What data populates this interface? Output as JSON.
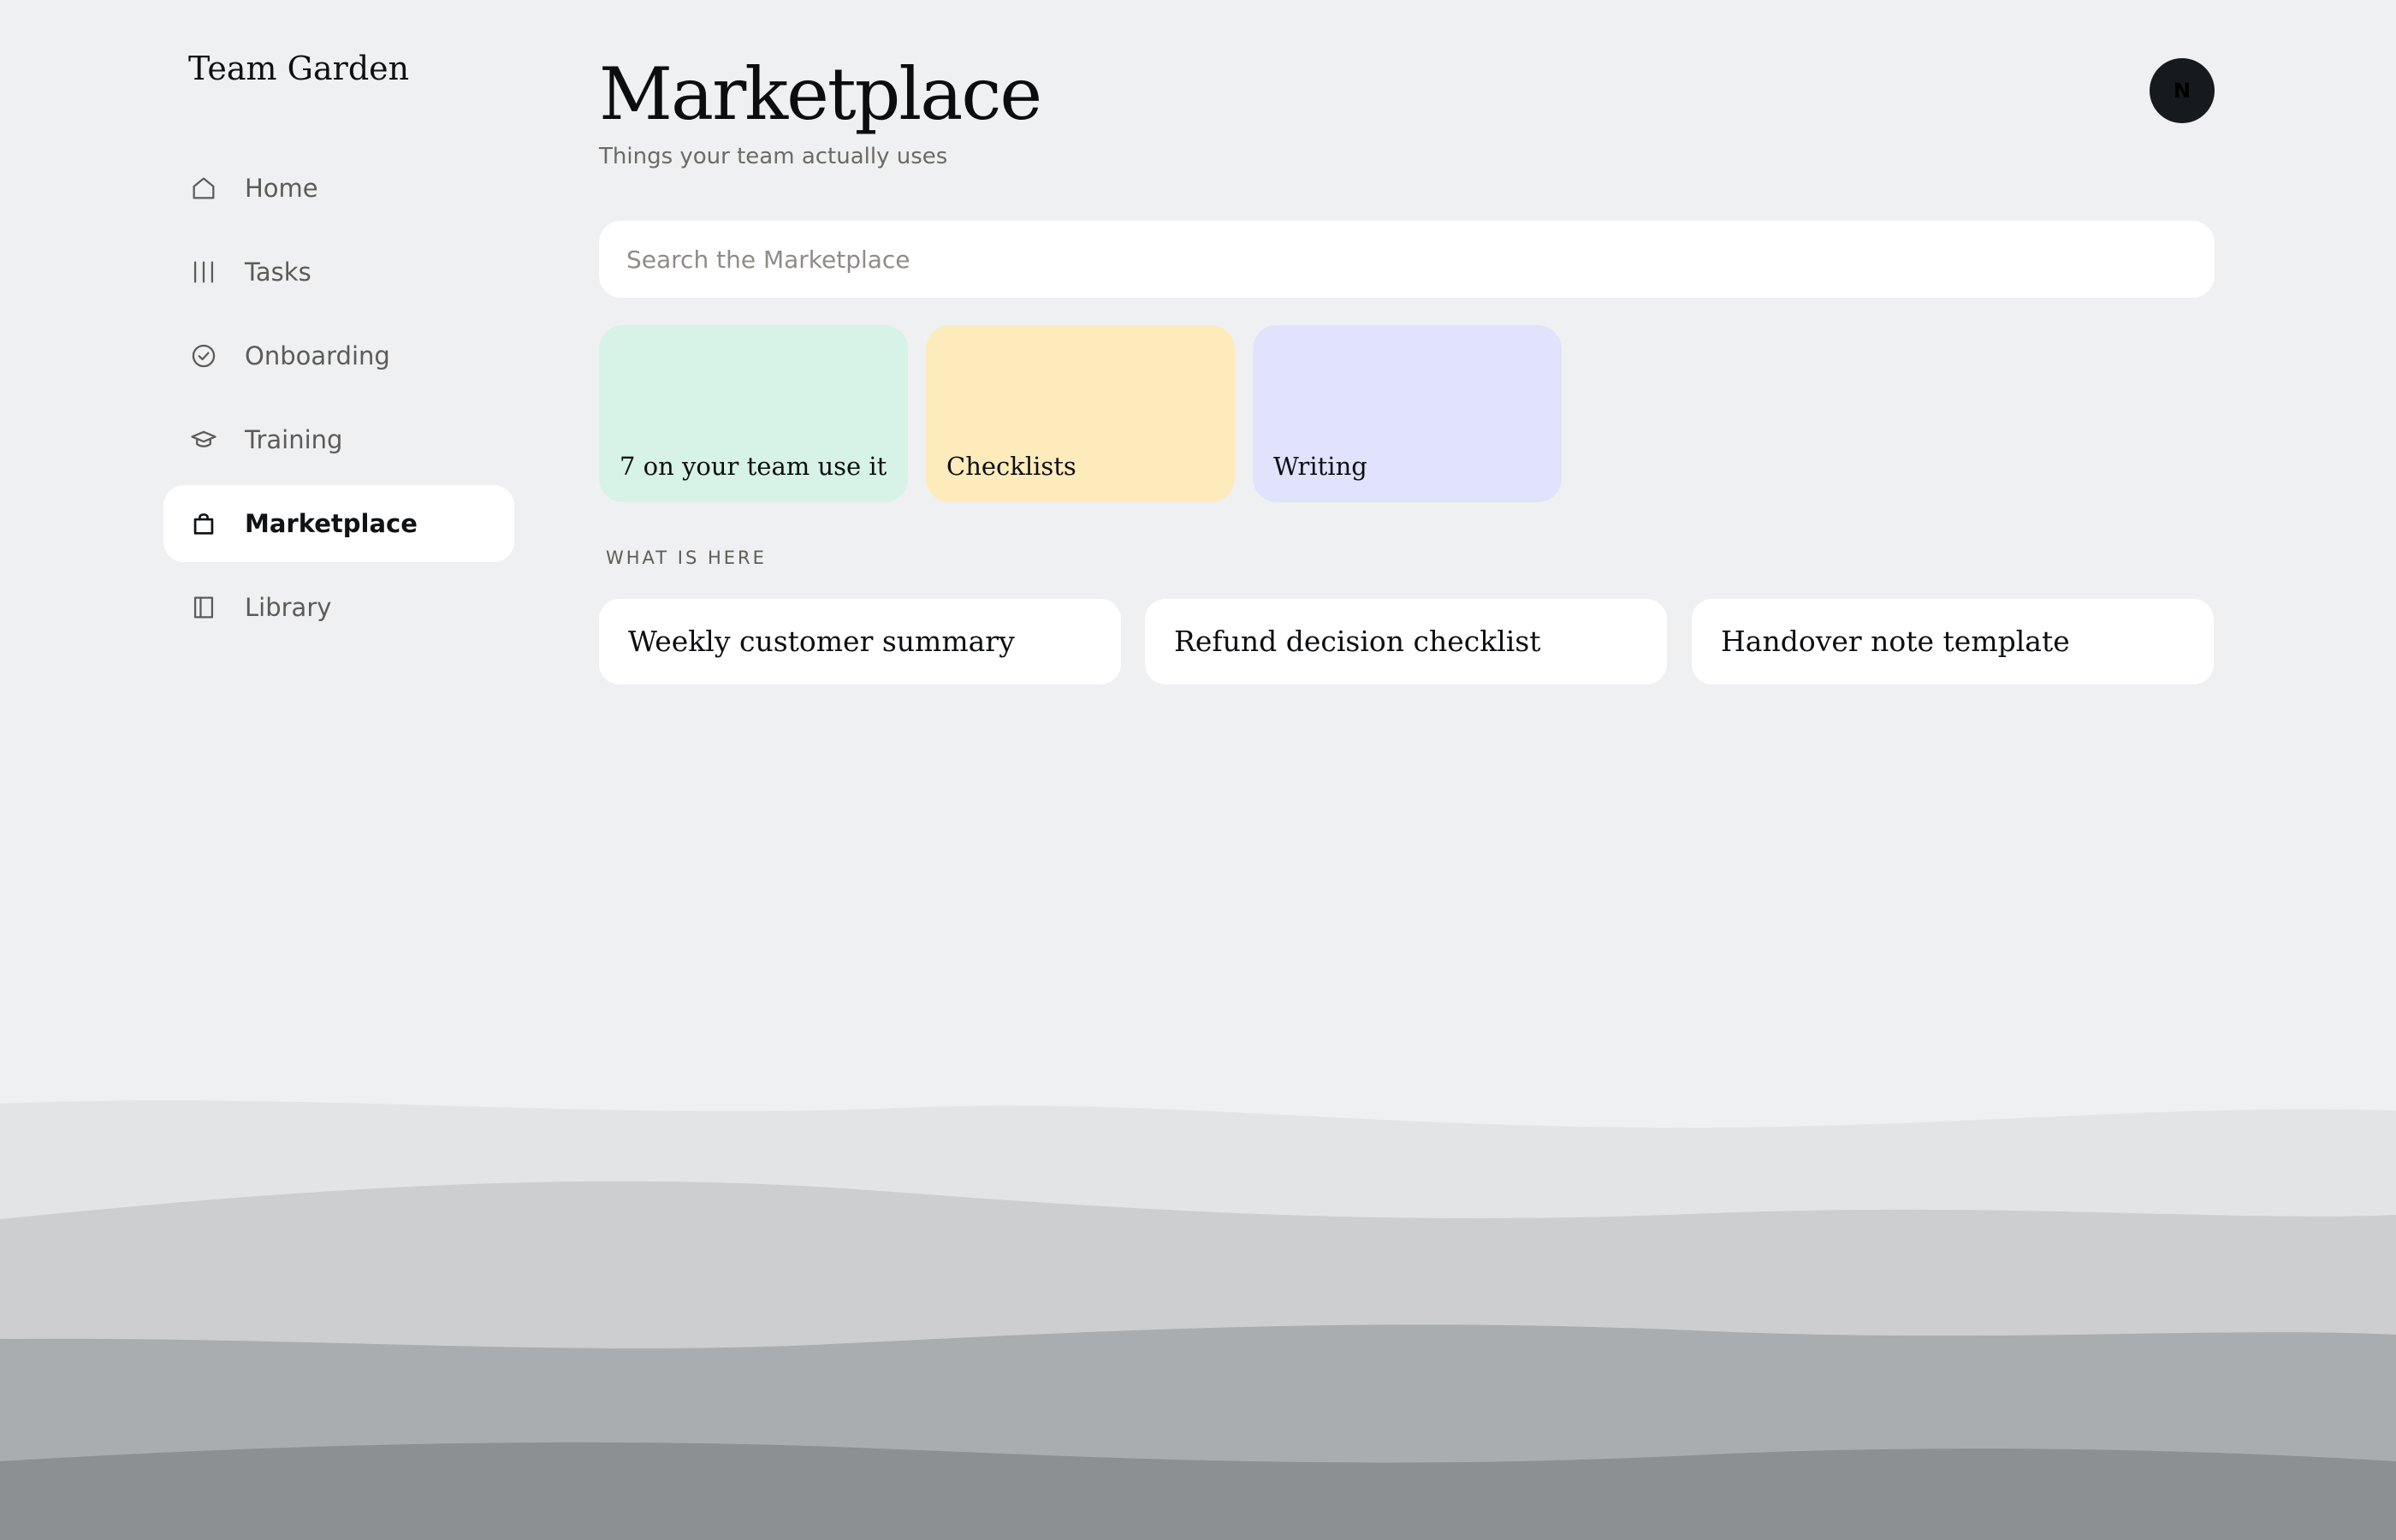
{
  "app": {
    "brand": "Team Garden",
    "avatar_initial": "N"
  },
  "sidebar": {
    "items": [
      {
        "label": "Home",
        "icon": "home-icon",
        "active": false
      },
      {
        "label": "Tasks",
        "icon": "tasks-icon",
        "active": false
      },
      {
        "label": "Onboarding",
        "icon": "check-circle-icon",
        "active": false
      },
      {
        "label": "Training",
        "icon": "graduation-cap-icon",
        "active": false
      },
      {
        "label": "Marketplace",
        "icon": "shopping-bag-icon",
        "active": true
      },
      {
        "label": "Library",
        "icon": "book-icon",
        "active": false
      }
    ]
  },
  "header": {
    "title": "Marketplace",
    "subtitle": "Things your team actually uses"
  },
  "search": {
    "placeholder": "Search the Marketplace",
    "value": ""
  },
  "categories": [
    {
      "label": "7 on your team use it",
      "color": "#d7f2e6"
    },
    {
      "label": "Checklists",
      "color": "#feebbc"
    },
    {
      "label": "Writing",
      "color": "#e1e2fc"
    }
  ],
  "section": {
    "label": "WHAT IS HERE"
  },
  "items": [
    {
      "title": "Weekly customer summary"
    },
    {
      "title": "Refund decision checklist"
    },
    {
      "title": "Handover note template"
    }
  ],
  "colors": {
    "page_background": "#eff0f2",
    "avatar": "#161a1f",
    "wave_1": "#e3e4e6",
    "wave_2": "#cdcecf",
    "wave_3": "#aaadaf",
    "wave_4": "#8d9092"
  }
}
